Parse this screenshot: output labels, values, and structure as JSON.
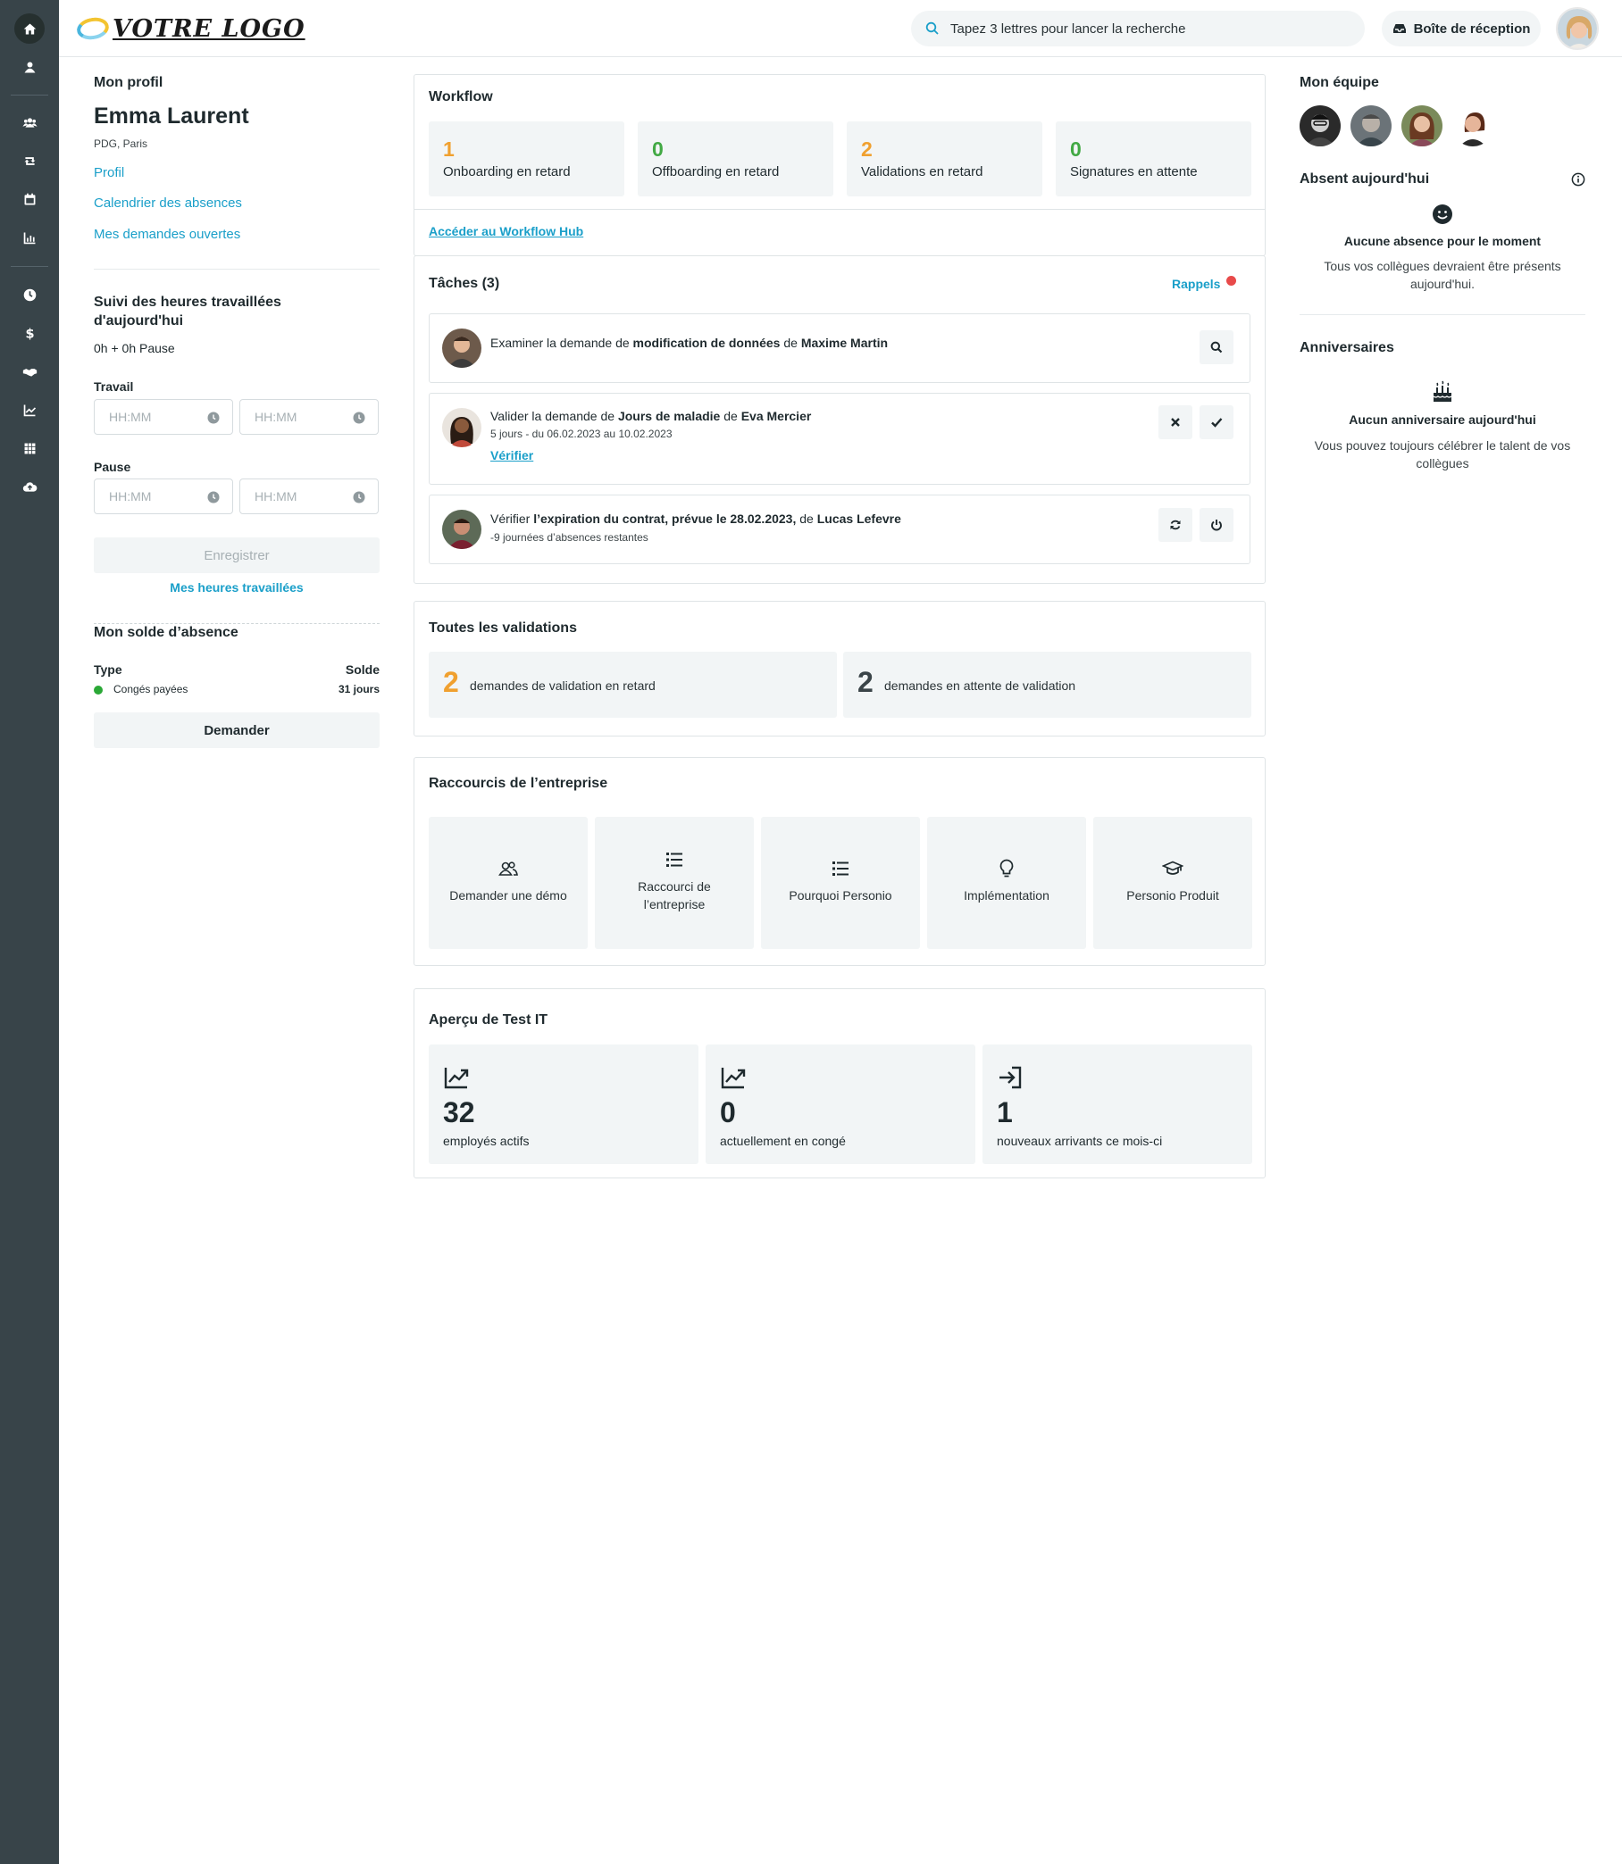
{
  "header": {
    "logo_text": "VOTRE LOGO",
    "search_placeholder": "Tapez 3 lettres pour lancer la recherche",
    "inbox_label": "Boîte de réception"
  },
  "profile": {
    "section_title": "Mon profil",
    "name": "Emma Laurent",
    "role": "PDG, Paris",
    "links": [
      "Profil",
      "Calendrier des absences",
      "Mes demandes ouvertes"
    ]
  },
  "time_tracking": {
    "title_line1": "Suivi des heures travaillées",
    "title_line2": "d'aujourd'hui",
    "summary": "0h + 0h Pause",
    "work_label": "Travail",
    "pause_label": "Pause",
    "placeholder": "HH:MM",
    "save_label": "Enregistrer",
    "hours_link": "Mes heures travaillées"
  },
  "absence_balance": {
    "title": "Mon solde d’absence",
    "type_header": "Type",
    "balance_header": "Solde",
    "rows": [
      {
        "type": "Congés payées",
        "balance": "31 jours",
        "color": "#2aa836"
      }
    ],
    "request_label": "Demander"
  },
  "workflow": {
    "title": "Workflow",
    "tiles": [
      {
        "value": "1",
        "label": "Onboarding en retard",
        "color": "orange"
      },
      {
        "value": "0",
        "label": "Offboarding en retard",
        "color": "green"
      },
      {
        "value": "2",
        "label": "Validations en retard",
        "color": "orange"
      },
      {
        "value": "0",
        "label": "Signatures en attente",
        "color": "green"
      }
    ],
    "hub_link": "Accéder au Workflow Hub"
  },
  "tasks": {
    "title": "Tâches (3)",
    "reminders_label": "Rappels",
    "items": [
      {
        "t1": "Examiner la demande de ",
        "b1": "modification de données",
        "t2": " de ",
        "b2": "Maxime Martin"
      },
      {
        "t1": "Valider la demande de ",
        "b1": "Jours de maladie",
        "t2": " de ",
        "b2": "Eva Mercier",
        "sub": "5 jours - du 06.02.2023 au 10.02.2023",
        "link": "Vérifier"
      },
      {
        "t1": "Vérifier ",
        "b1": "l’expiration du contrat, prévue le 28.02.2023,",
        "t2": " de ",
        "b2": "Lucas Lefevre",
        "sub": "-9 journées d’absences restantes"
      }
    ]
  },
  "validations": {
    "title": "Toutes les validations",
    "tiles": [
      {
        "value": "2",
        "label": "demandes de validation en retard"
      },
      {
        "value": "2",
        "label": "demandes en attente de validation"
      }
    ]
  },
  "shortcuts": {
    "title": "Raccourcis de l’entreprise",
    "items": [
      {
        "icon": "users-icon",
        "line1": "Demander une démo",
        "line2": ""
      },
      {
        "icon": "list-icon",
        "line1": "Raccourci de",
        "line2": "l’entreprise"
      },
      {
        "icon": "list-icon",
        "line1": "Pourquoi Personio",
        "line2": ""
      },
      {
        "icon": "lightbulb-icon",
        "line1": "Implémentation",
        "line2": ""
      },
      {
        "icon": "graduation-cap-icon",
        "line1": "Personio Produit",
        "line2": ""
      }
    ]
  },
  "overview": {
    "title": "Aperçu de Test IT",
    "tiles": [
      {
        "icon": "trend-icon",
        "value": "32",
        "label": "employés actifs"
      },
      {
        "icon": "trend-icon",
        "value": "0",
        "label": "actuellement en congé"
      },
      {
        "icon": "sign-in-icon",
        "value": "1",
        "label": "nouveaux arrivants ce mois-ci"
      }
    ]
  },
  "team": {
    "title": "Mon équipe"
  },
  "absent": {
    "title": "Absent aujourd'hui",
    "empty_title": "Aucune absence pour le moment",
    "empty_line1": "Tous vos collègues devraient être présents",
    "empty_line2": "aujourd'hui."
  },
  "birthdays": {
    "title": "Anniversaires",
    "empty_title": "Aucun anniversaire aujourd'hui",
    "empty_line1": "Vous pouvez toujours célébrer le talent de vos",
    "empty_line2": "collègues"
  },
  "colors": {
    "sidebar": "#384449",
    "accent": "#1a9fc9",
    "orange": "#f0a02f",
    "green": "#42a944",
    "reminder_dot": "#e84a4a"
  }
}
